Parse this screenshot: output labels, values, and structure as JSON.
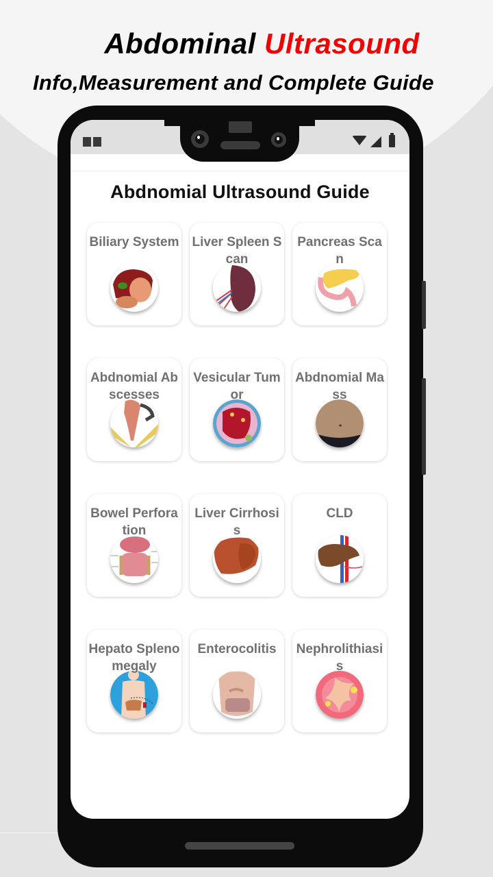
{
  "promo": {
    "title_part1": "Abdominal ",
    "title_part2": "Ultrasound",
    "subtitle": "Info,Measurement and Complete Guide",
    "accent_color": "#f50000"
  },
  "status_bar": {
    "left_icon": "notification-icon",
    "right_icons": [
      "wifi-icon",
      "signal-icon",
      "battery-icon"
    ]
  },
  "app": {
    "title": "Abdnomial Ultrasound Guide",
    "cards": [
      {
        "label": "Biliary System",
        "icon": "biliary-system-illustration"
      },
      {
        "label": "Liver Spleen Scan",
        "icon": "spleen-illustration"
      },
      {
        "label": "Pancreas Scan",
        "icon": "pancreas-illustration"
      },
      {
        "label": "Abdnomial Abscesses",
        "icon": "abscess-drainage-illustration"
      },
      {
        "label": "Vesicular Tumor",
        "icon": "vesicular-tumor-illustration"
      },
      {
        "label": "Abdnomial Mass",
        "icon": "abdomen-photo"
      },
      {
        "label": "Bowel Perforation",
        "icon": "bowel-illustration"
      },
      {
        "label": "Liver Cirrhosis",
        "icon": "cirrhotic-liver-illustration"
      },
      {
        "label": "CLD",
        "icon": "liver-vessels-illustration"
      },
      {
        "label": "Hepato Splenomegaly",
        "icon": "body-silhouette-illustration"
      },
      {
        "label": "Enterocolitis",
        "icon": "intestines-illustration"
      },
      {
        "label": "Nephrolithiasis",
        "icon": "kidney-stone-illustration"
      }
    ]
  }
}
